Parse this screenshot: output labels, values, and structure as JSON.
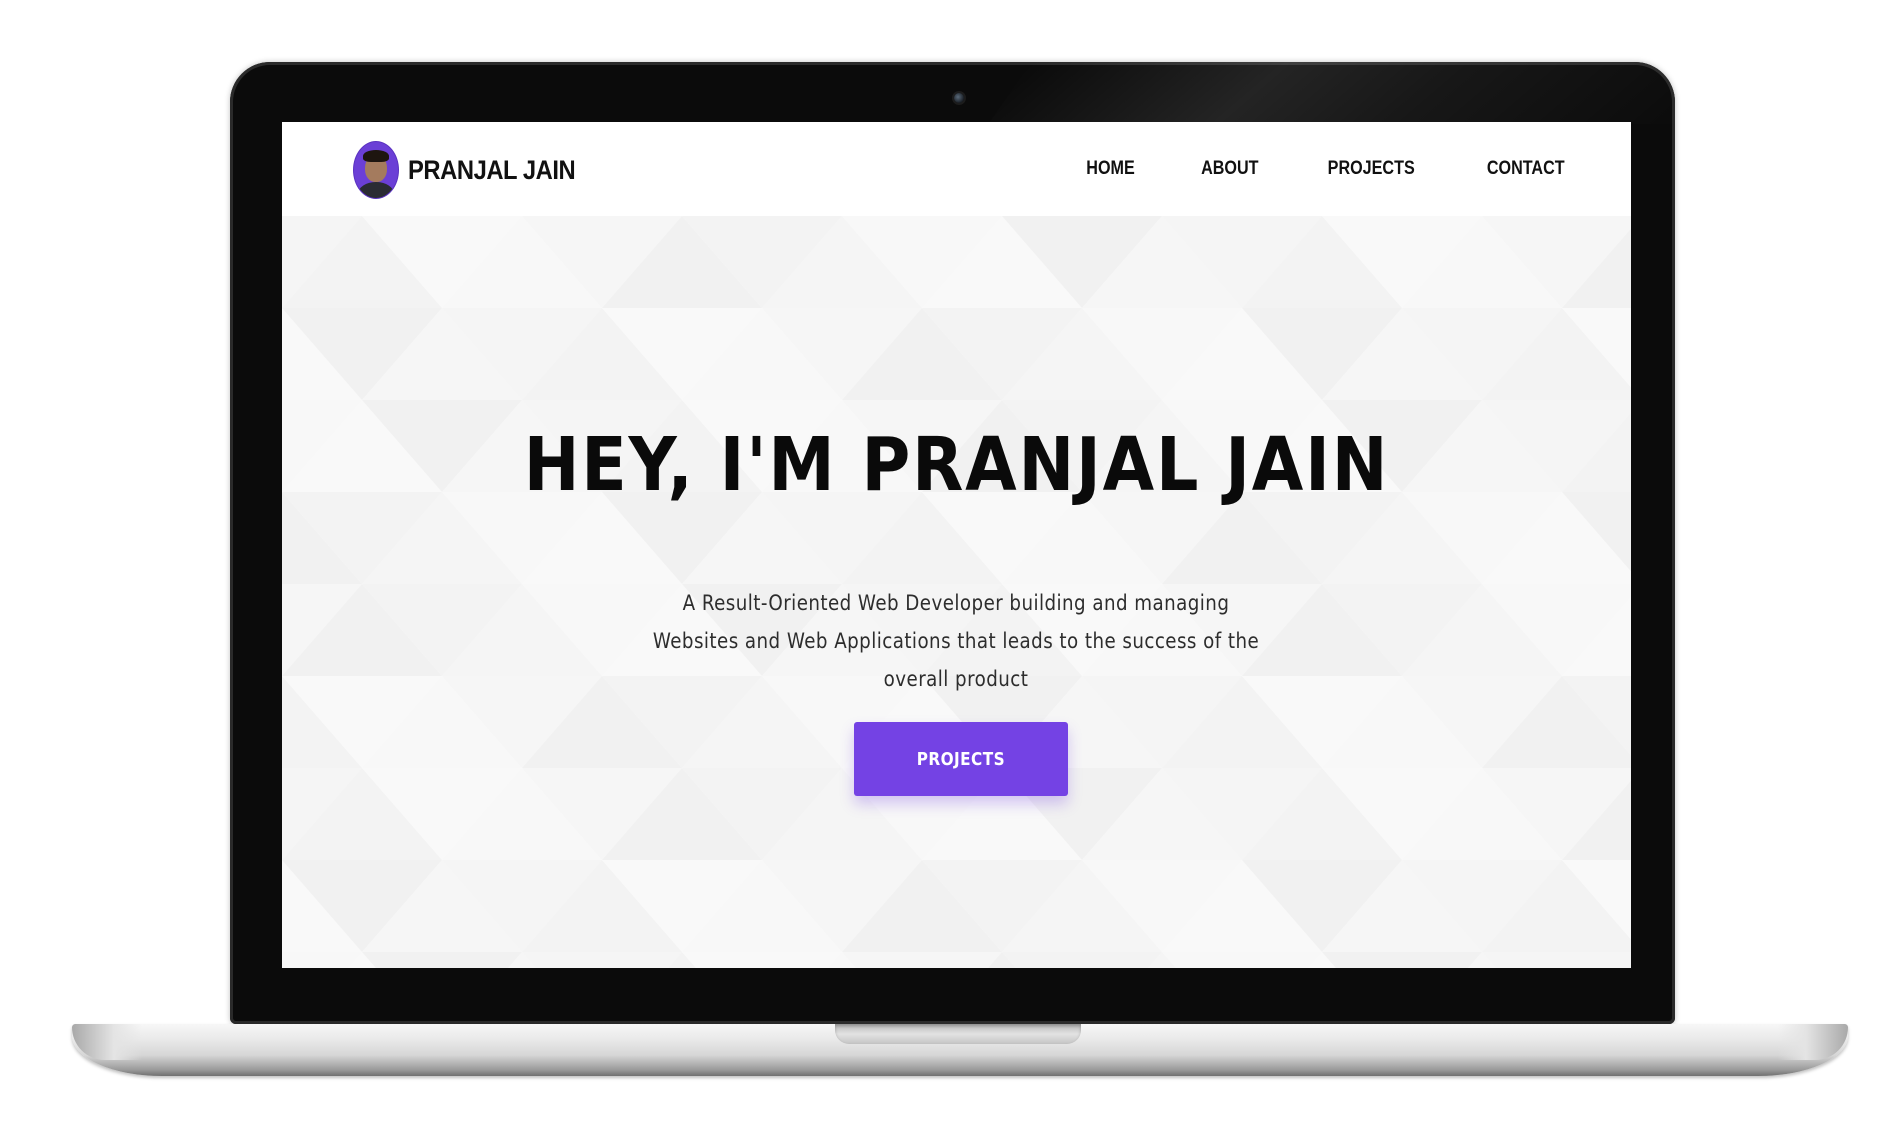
{
  "site": {
    "brand_name": "PRANJAL JAIN",
    "avatar_label": "profile-photo"
  },
  "nav": {
    "items": [
      {
        "label": "HOME"
      },
      {
        "label": "ABOUT"
      },
      {
        "label": "PROJECTS"
      },
      {
        "label": "CONTACT"
      }
    ]
  },
  "hero": {
    "title": "HEY, I'M PRANJAL JAIN",
    "subtitle": "A Result-Oriented Web Developer building and managing Websites and Web Applications that leads to the success of the overall product",
    "cta_label": "PROJECTS"
  },
  "colors": {
    "accent": "#7442e4",
    "text": "#111111",
    "bezel": "#0b0b0b",
    "hero_bg": "#fbfbfb"
  }
}
